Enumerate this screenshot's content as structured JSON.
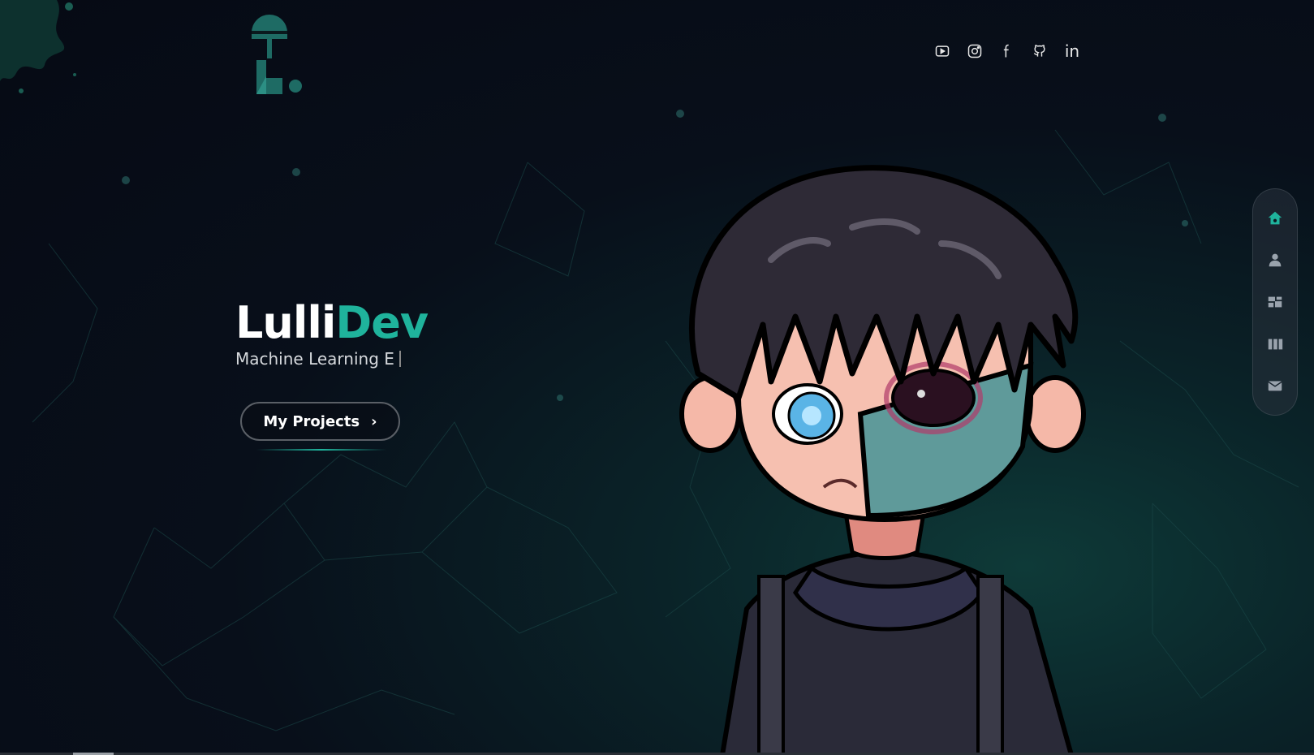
{
  "header": {
    "logo_icon": "lollipop-L-logo",
    "socials": [
      {
        "name": "youtube-icon"
      },
      {
        "name": "instagram-icon"
      },
      {
        "name": "facebook-icon"
      },
      {
        "name": "github-icon"
      },
      {
        "name": "linkedin-icon",
        "label": "in"
      }
    ]
  },
  "hero": {
    "brand_part1": "Lulli",
    "brand_part2": "Dev",
    "subtitle": "Machine Learning E",
    "cta_label": "My Projects",
    "cta_arrow": "›"
  },
  "sidenav": {
    "items": [
      {
        "name": "home-icon",
        "active": true
      },
      {
        "name": "user-icon",
        "active": false
      },
      {
        "name": "dashboard-icon",
        "active": false
      },
      {
        "name": "columns-icon",
        "active": false
      },
      {
        "name": "mail-icon",
        "active": false
      }
    ]
  },
  "colors": {
    "accent": "#1fb39c",
    "background": "#080f1a",
    "nav_inactive": "#9aa3ad"
  }
}
